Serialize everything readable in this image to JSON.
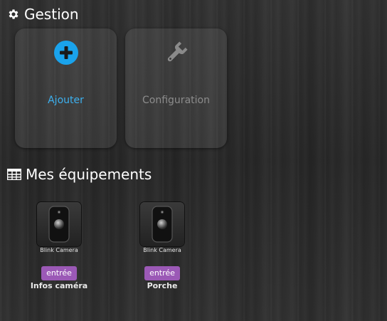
{
  "gestion": {
    "title": "Gestion",
    "actions": [
      {
        "label": "Ajouter",
        "icon": "plus-circle-icon",
        "color": "#3cb0ef"
      },
      {
        "label": "Configuration",
        "icon": "wrench-icon",
        "color": "#8c8c8c"
      }
    ]
  },
  "equipements": {
    "title": "Mes équipements",
    "icon": "table-icon",
    "devices": [
      {
        "thumb_label": "Blink Camera",
        "badge": "entrée",
        "name": "Infos caméra"
      },
      {
        "thumb_label": "Blink Camera",
        "badge": "entrée",
        "name": "Porche"
      }
    ],
    "badge_color": "#9b59b6"
  }
}
